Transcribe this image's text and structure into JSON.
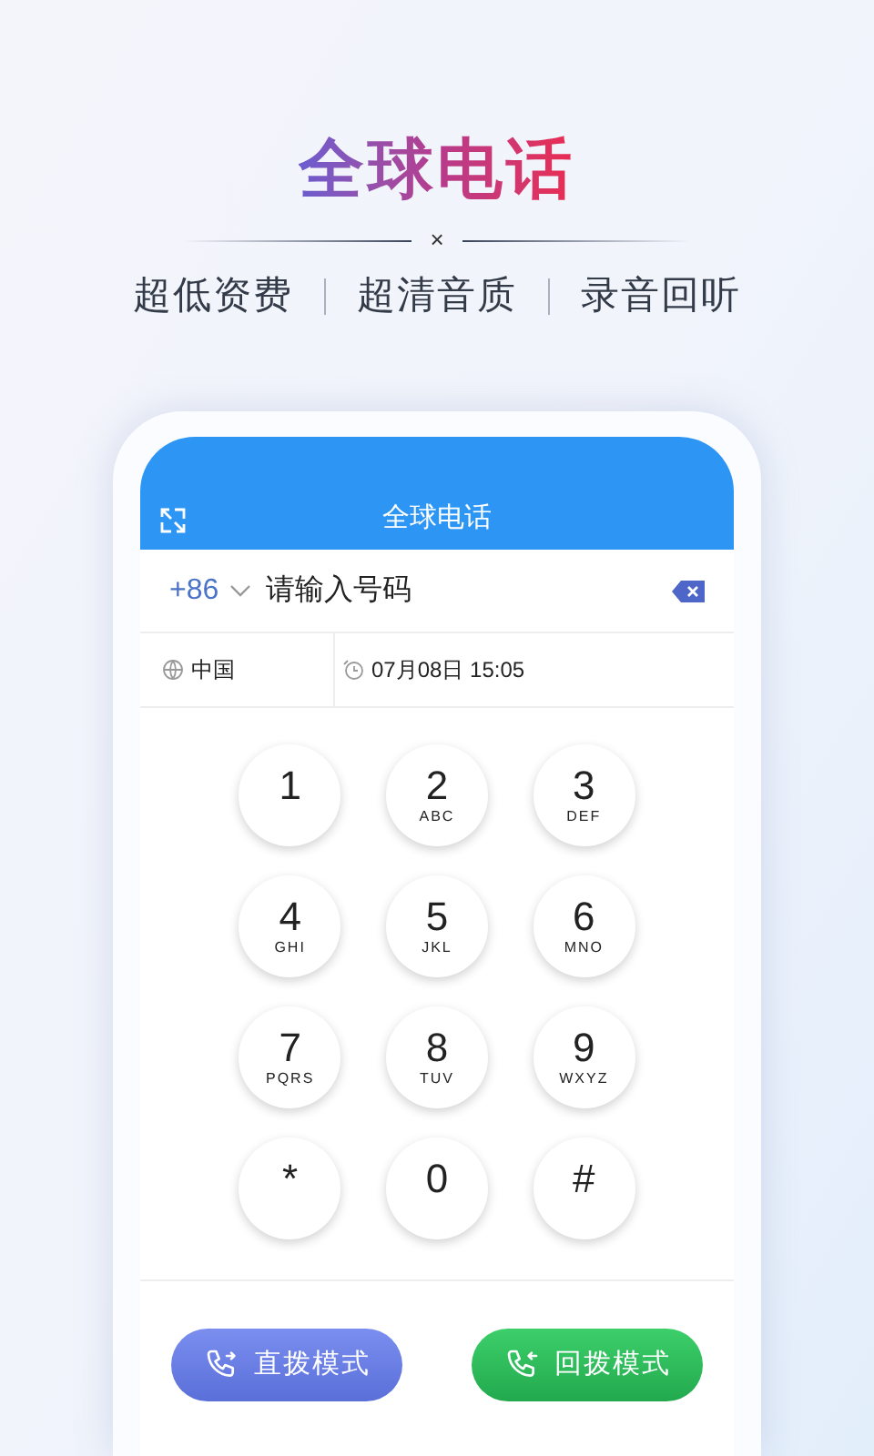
{
  "headline": "全球电话",
  "separator": "×",
  "features": [
    "超低资费",
    "超清音质",
    "录音回听"
  ],
  "app": {
    "title": "全球电话",
    "dial": {
      "country_code": "+86",
      "placeholder": "请输入号码"
    },
    "info": {
      "country": "中国",
      "datetime": "07月08日 15:05"
    },
    "keys": [
      {
        "digit": "1"
      },
      {
        "digit": "2",
        "letters": "ABC"
      },
      {
        "digit": "3",
        "letters": "DEF"
      },
      {
        "digit": "4",
        "letters": "GHI"
      },
      {
        "digit": "5",
        "letters": "JKL"
      },
      {
        "digit": "6",
        "letters": "MNO"
      },
      {
        "digit": "7",
        "letters": "PQRS"
      },
      {
        "digit": "8",
        "letters": "TUV"
      },
      {
        "digit": "9",
        "letters": "WXYZ"
      },
      {
        "digit": "*"
      },
      {
        "digit": "0"
      },
      {
        "digit": "#"
      }
    ],
    "modes": [
      {
        "label": "直拨模式",
        "kind": "direct"
      },
      {
        "label": "回拨模式",
        "kind": "callback"
      }
    ]
  }
}
